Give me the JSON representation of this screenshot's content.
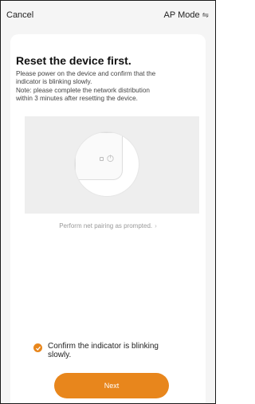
{
  "nav": {
    "cancel": "Cancel",
    "mode": "AP Mode",
    "mode_icon": "swap-icon"
  },
  "content": {
    "title": "Reset the device first.",
    "desc_lines": [
      "Please power on the device and confirm that the",
      "indicator is blinking slowly.",
      "Note: please complete the network distribution",
      "within 3 minutes after resetting the device."
    ],
    "hint": "Perform net pairing as prompted."
  },
  "confirm": {
    "label": "Confirm the indicator is blinking slowly.",
    "checked": true
  },
  "next_button": "Next",
  "colors": {
    "accent": "#e8861c",
    "background": "#f5f5f5",
    "card": "#ffffff"
  }
}
